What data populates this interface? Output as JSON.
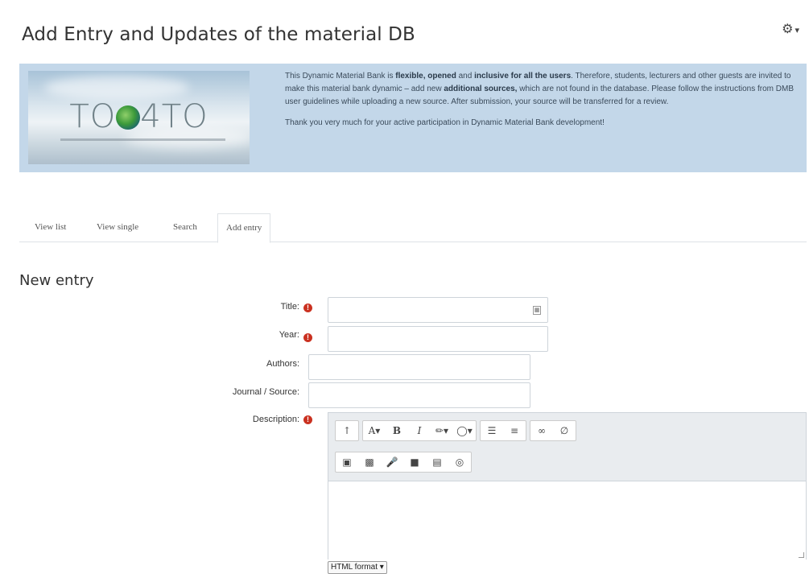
{
  "page": {
    "title": "Add Entry and Updates of the material DB",
    "settings_caret": "▾"
  },
  "banner": {
    "logo_left": "TO",
    "logo_right": "4TO",
    "p1_a": "This Dynamic Material Bank is ",
    "p1_b": "flexible, opened",
    "p1_c": " and ",
    "p1_d": "inclusive for all the users",
    "p1_e": ". Therefore, students, lecturers and other guests are invited to make this material bank dynamic – add new ",
    "p1_f": "additional sources,",
    "p1_g": " which are not found in the database. Please follow the instructions from DMB user guidelines while uploading a new source. After submission, your source will be transferred for a review.",
    "p2": "Thank you very much for your active participation in Dynamic Material Bank development!"
  },
  "tabs": [
    "View list",
    "View single",
    "Search",
    "Add entry"
  ],
  "active_tab": "Add entry",
  "form": {
    "heading": "New entry",
    "fields": {
      "title": "Title:",
      "year": "Year:",
      "authors": "Authors:",
      "journal": "Journal / Source:",
      "description": "Description:"
    },
    "required_mark": "!",
    "format": "HTML format"
  },
  "colors": {
    "banner_bg": "#c3d7e9",
    "required": "#ca3120"
  },
  "icons": [
    "gear-icon",
    "required-icon",
    "calendar-icon",
    "paragraph-icon",
    "font-icon",
    "bold-icon",
    "italic-icon",
    "brush-icon",
    "lightbulb-icon",
    "unordered-list-icon",
    "ordered-list-icon",
    "link-icon",
    "unlink-icon",
    "image-icon",
    "media-icon",
    "microphone-icon",
    "video-icon",
    "manage-files-icon",
    "accessibility-icon"
  ]
}
